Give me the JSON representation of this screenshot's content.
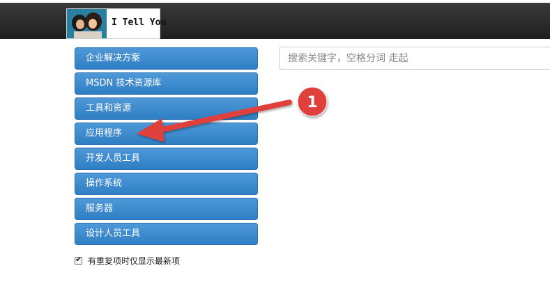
{
  "header": {
    "logo_text": "I Tell You"
  },
  "search": {
    "placeholder": "搜索关键字，空格分词 走起"
  },
  "sidebar": {
    "items": [
      {
        "label": "企业解决方案"
      },
      {
        "label": "MSDN 技术资源库"
      },
      {
        "label": "工具和资源"
      },
      {
        "label": "应用程序"
      },
      {
        "label": "开发人员工具"
      },
      {
        "label": "操作系统"
      },
      {
        "label": "服务器"
      },
      {
        "label": "设计人员工具"
      }
    ]
  },
  "filter": {
    "checked": true,
    "label": "有重复项时仅显示最新项"
  },
  "annotation": {
    "badge_number": "1",
    "arrow_color": "#e0403a"
  }
}
